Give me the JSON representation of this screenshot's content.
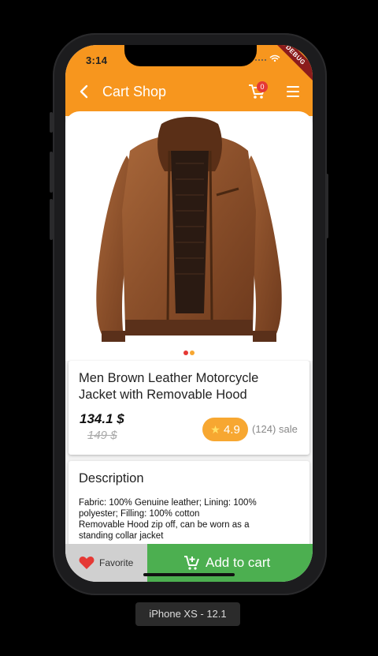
{
  "status": {
    "time": "3:14",
    "debug_label": "DEBUG"
  },
  "appbar": {
    "title": "Cart Shop",
    "cart_count": "0"
  },
  "product": {
    "title_line1": "Men Brown Leather Motorcycle",
    "title_line2": "Jacket with Removable Hood",
    "price": "134.1 $",
    "old_price": "149 $",
    "rating": "4.9",
    "sales": "(124) sale",
    "image_icon": "leather-jacket-image",
    "carousel_count": 2,
    "carousel_active": 1
  },
  "description": {
    "heading": "Description",
    "lines": [
      "Fabric: 100% Genuine leather; Lining: 100%",
      "polyester; Filling: 100% cotton",
      "Removable Hood zip off, can be worn as a",
      "standing collar jacket"
    ]
  },
  "bottom_bar": {
    "favorite_label": "Favorite",
    "add_to_cart_label": "Add to cart"
  },
  "device": {
    "label": "iPhone XS - 12.1"
  },
  "colors": {
    "accent": "#f7961e",
    "rating": "#f7a731",
    "cart_button": "#4caf50",
    "favorite_heart": "#e53935",
    "badge": "#e53935"
  }
}
